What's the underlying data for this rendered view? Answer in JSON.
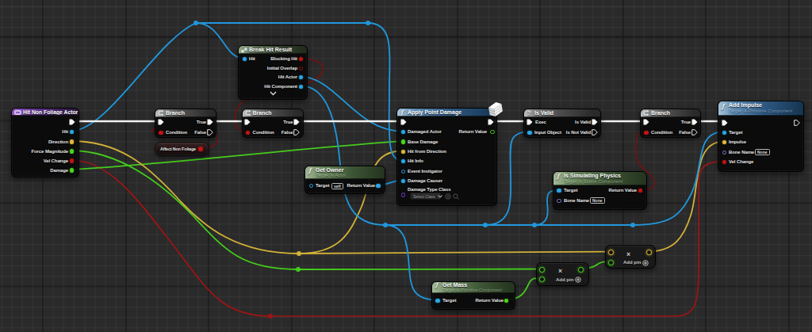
{
  "palette": {
    "exec_wire": "#f2f2f2",
    "object_wire": "#2097dc",
    "vector_wire": "#d3b138",
    "float_wire": "#45cb1d",
    "bool_wire": "#a01414",
    "bool_wire_dim": "#7b1010",
    "event_header": "#63368e",
    "function_header": "#2d5881",
    "pure_function_header": "#3c5434",
    "macro_header": "#4e4e4e"
  },
  "nodes": {
    "hit_event": {
      "title": "Hit Non Foliage Actor",
      "outputs": [
        "Hit",
        "Direction",
        "Force Magnitude",
        "Vel Change",
        "Damage"
      ]
    },
    "branch": {
      "title": "Branch",
      "condition": "Condition",
      "true_label": "True",
      "false_label": "False"
    },
    "affect_pill": {
      "label": "Affect Non Foliage"
    },
    "break_hit": {
      "title": "Break Hit Result",
      "input": "Hit",
      "outputs": [
        "Blocking Hit",
        "Initial Overlap",
        "Hit Actor",
        "Hit Component"
      ]
    },
    "get_owner": {
      "title": "Get Owner",
      "subtitle": "Target is Actor",
      "target": "Target",
      "target_value": "self",
      "return_label": "Return Value"
    },
    "apply_point_damage": {
      "title": "Apply Point Damage",
      "inputs": [
        "Damaged Actor",
        "Base Damage",
        "Hit from Direction",
        "Hit Info",
        "Event Instigator",
        "Damage Causer",
        "Damage Type Class"
      ],
      "select_class": "Select Class",
      "return_label": "Return Value"
    },
    "is_valid": {
      "title": "Is Valid",
      "icon": "?",
      "exec": "Exec",
      "input_object": "Input Object",
      "is_valid": "Is Valid",
      "is_not_valid": "Is Not Valid"
    },
    "is_simulating": {
      "title": "Is  Simulating Physics",
      "subtitle": "Target is Scene Component",
      "target": "Target",
      "bone_name": "Bone Name",
      "bone_value": "None",
      "return_label": "Return Value"
    },
    "add_impulse": {
      "title": "Add Impulse",
      "subtitle": "Target is Primitive Component",
      "inputs": [
        "Target",
        "Impulse",
        "Bone Name",
        "Vel Change"
      ],
      "bone_value": "None"
    },
    "get_mass": {
      "title": "Get Mass",
      "subtitle": "Target is Primitive Component",
      "target": "Target",
      "return_label": "Return Value"
    },
    "multiply": {
      "symbol": "×",
      "add_pin": "Add pin"
    }
  }
}
